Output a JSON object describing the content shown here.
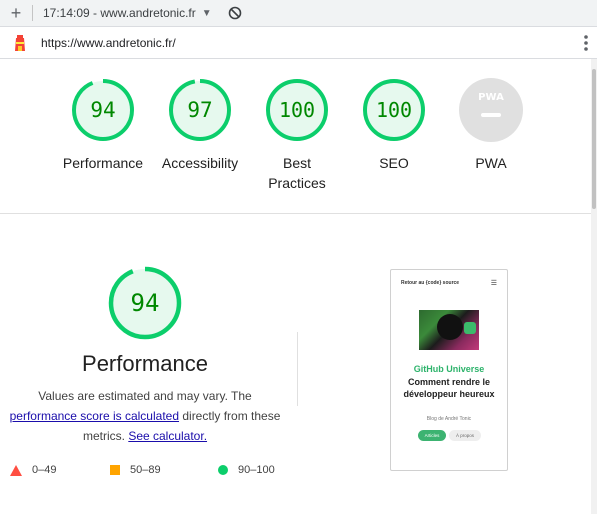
{
  "browser": {
    "new_tab_label": "+",
    "tab_title": "17:14:09 - www.andretonic.fr",
    "address": "https://www.andretonic.fr/"
  },
  "categories": [
    {
      "score": "94",
      "label_line1": "Performance",
      "label_line2": "",
      "value": 94
    },
    {
      "score": "97",
      "label_line1": "Accessibility",
      "label_line2": "",
      "value": 97
    },
    {
      "score": "100",
      "label_line1": "Best",
      "label_line2": "Practices",
      "value": 100
    },
    {
      "score": "100",
      "label_line1": "SEO",
      "label_line2": "",
      "value": 100
    },
    {
      "score": "PWA",
      "label_line1": "PWA",
      "label_line2": "",
      "value": null
    }
  ],
  "performance": {
    "score": "94",
    "score_value": 94,
    "title": "Performance",
    "desc_1": "Values are estimated and may vary. The",
    "desc_link": "performance score is calculated",
    "desc_2": " directly from these",
    "desc_3": "metrics. ",
    "calc_link": "See calculator.",
    "legend": {
      "fail": "0–49",
      "average": "50–89",
      "pass": "90–100"
    }
  },
  "preview": {
    "header": "Retour au {code} source",
    "menu": "☰",
    "brand": "GitHub Universe",
    "headline": "Comment rendre le développeur heureux",
    "byline": "Blog de André Tonic",
    "btn_articles": "Articles",
    "btn_apropos": "À propos"
  },
  "colors": {
    "pass": "#0cce6b",
    "pass_text": "#008800",
    "pass_fill": "#e6f9ee",
    "average": "#ffa400",
    "fail": "#ff4e42",
    "pwa_gray": "#e0e0e0"
  }
}
